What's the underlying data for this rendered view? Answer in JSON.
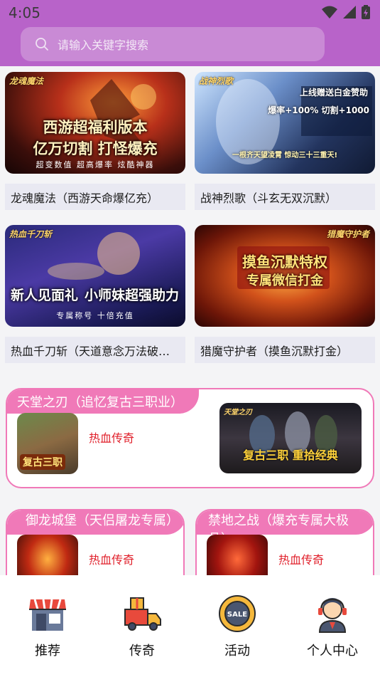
{
  "status_bar": {
    "time": "4:05"
  },
  "search": {
    "placeholder": "请输入关键字搜索"
  },
  "cards": [
    {
      "title": "龙魂魔法（西游天命爆亿充）",
      "banner_logo": "龙魂魔法",
      "banner_line1": "西游超福利版本",
      "banner_line2": "亿万切割 打怪爆充",
      "banner_sub": "超变数值 超高爆率 炫酷神器"
    },
    {
      "title": "战神烈歌（斗玄无双沉默）",
      "banner_logo": "战神烈歌",
      "banner_line1": "上线赠送白金赞助",
      "banner_line2": "爆率+100%  切割+1000",
      "banner_sub": "一根齐天望凌霄 惊动三十三重天!"
    },
    {
      "title": "热血千刀斩（天道意念万法破…",
      "banner_logo": "热血千刀斩",
      "banner_line1": "新人见面礼",
      "banner_line2": "小师妹超强助力",
      "banner_sub": "专属称号 十倍充值"
    },
    {
      "title": "猎魔守护者（摸鱼沉默打金）",
      "banner_logo": "猎魔守护者",
      "banner_line1": "摸鱼沉默特权",
      "banner_line2": "专属微信打金",
      "banner_sub": ""
    }
  ],
  "featured": {
    "title": "天堂之刃（追忆复古三职业）",
    "tag": "热血传奇",
    "thumb_text": "复古三职",
    "banner_text": "复古三职 重拾经典",
    "banner_logo": "天堂之刃"
  },
  "small_cards": [
    {
      "title": "御龙城堡（天侣屠龙专属）",
      "tag": "热血传奇"
    },
    {
      "title": "禁地之战（爆充专属大极品）",
      "tag": "热血传奇"
    }
  ],
  "nav": [
    {
      "label": "推荐",
      "icon": "store-icon"
    },
    {
      "label": "传奇",
      "icon": "delivery-truck-icon"
    },
    {
      "label": "活动",
      "icon": "sale-badge-icon"
    },
    {
      "label": "个人中心",
      "icon": "support-agent-icon"
    }
  ],
  "colors": {
    "header": "#b863c9",
    "accent_pink": "#f079b8",
    "tag_red": "#e01f2a"
  }
}
